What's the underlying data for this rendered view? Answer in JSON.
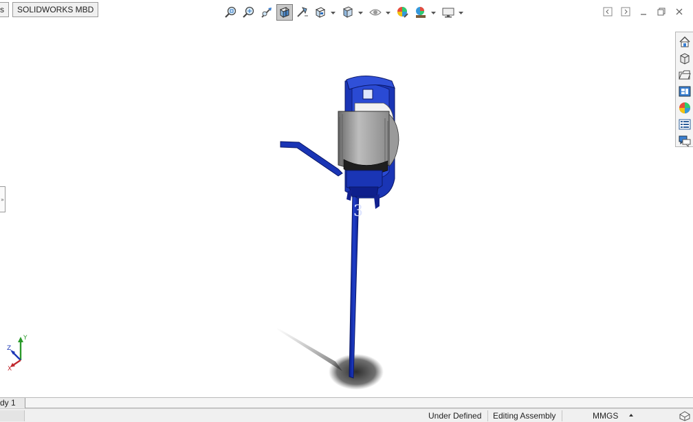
{
  "tabs": [
    {
      "label": "s"
    },
    {
      "label": "SOLIDWORKS MBD"
    }
  ],
  "hud_toolbar": [
    {
      "name": "zoom-to-fit-icon"
    },
    {
      "name": "zoom-to-area-icon"
    },
    {
      "name": "previous-view-icon"
    },
    {
      "name": "section-view-icon",
      "active": true
    },
    {
      "name": "dynamic-annotation-views-icon"
    },
    {
      "name": "view-orientation-icon"
    },
    {
      "name": "display-style-icon"
    },
    {
      "name": "hide-show-items-icon"
    },
    {
      "name": "edit-appearance-icon"
    },
    {
      "name": "apply-scene-icon"
    },
    {
      "name": "view-settings-icon"
    }
  ],
  "window_controls": [
    "tile-left-icon",
    "tile-right-icon",
    "minimize-icon",
    "restore-icon",
    "close-icon"
  ],
  "task_pane": [
    {
      "name": "solidworks-resources-icon"
    },
    {
      "name": "design-library-icon"
    },
    {
      "name": "file-explorer-icon"
    },
    {
      "name": "view-palette-icon"
    },
    {
      "name": "appearances-scenes-icon"
    },
    {
      "name": "custom-properties-icon"
    },
    {
      "name": "solidworks-forum-icon"
    }
  ],
  "feature_manager_handle": "»",
  "triad": {
    "y": "Y",
    "z": "Z",
    "x": "X"
  },
  "model_tab": "dy 1",
  "status": {
    "state": "Under Defined",
    "mode": "Editing Assembly",
    "units": "MMGS"
  },
  "colors": {
    "model_blue": "#1a35b5",
    "model_grey": "#9a9a9a",
    "triad_y": "#2a9a2a",
    "triad_z": "#1a35b5",
    "triad_x": "#c0272d"
  }
}
